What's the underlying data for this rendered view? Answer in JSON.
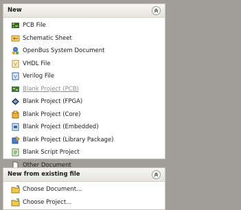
{
  "new_panel": {
    "title": "New",
    "items": [
      {
        "label": "PCB File",
        "icon": "pcb-file-icon",
        "enabled": true
      },
      {
        "label": "Schematic Sheet",
        "icon": "schematic-sheet-icon",
        "enabled": true
      },
      {
        "label": "OpenBus System Document",
        "icon": "openbus-document-icon",
        "enabled": true
      },
      {
        "label": "VHDL File",
        "icon": "vhdl-file-icon",
        "enabled": true
      },
      {
        "label": "Verilog File",
        "icon": "verilog-file-icon",
        "enabled": true
      },
      {
        "label": "Blank Project (PCB)",
        "icon": "pcb-project-icon",
        "enabled": false
      },
      {
        "label": "Blank Project (FPGA)",
        "icon": "fpga-project-icon",
        "enabled": true
      },
      {
        "label": "Blank Project (Core)",
        "icon": "core-project-icon",
        "enabled": true
      },
      {
        "label": "Blank Project (Embedded)",
        "icon": "embedded-project-icon",
        "enabled": true
      },
      {
        "label": "Blank Project (Library Package)",
        "icon": "library-package-icon",
        "enabled": true
      },
      {
        "label": "Blank Script Project",
        "icon": "script-project-icon",
        "enabled": true
      },
      {
        "label": "Other Document",
        "icon": "document-icon",
        "enabled": true
      }
    ]
  },
  "existing_panel": {
    "title": "New from existing file",
    "items": [
      {
        "label": "Choose Document...",
        "icon": "choose-document-icon"
      },
      {
        "label": "Choose Project...",
        "icon": "choose-project-icon"
      }
    ]
  },
  "colors": {
    "background": "#a19e99",
    "panel": "#ffffff",
    "disabled_text": "#8d8d8d"
  }
}
